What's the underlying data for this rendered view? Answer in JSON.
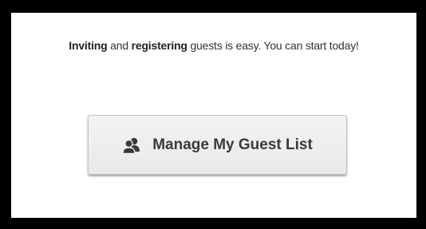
{
  "intro": {
    "part1": "Inviting",
    "part2": " and ",
    "part3": "registering",
    "part4": " guests is easy. You can start today!"
  },
  "manage_button": {
    "label": "Manage My Guest List",
    "icon": "users-icon"
  },
  "colors": {
    "background": "#000000",
    "panel": "#ffffff",
    "button_bg": "#eeeeee",
    "button_text": "#3a3a3a"
  }
}
